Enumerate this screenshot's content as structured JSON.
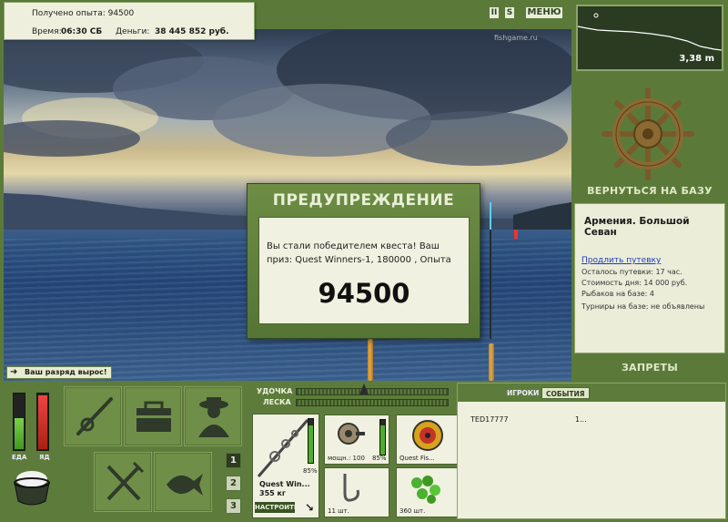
{
  "top_info": {
    "experience_text": "Получено опыта: 94500",
    "time_label": "Время:",
    "time_value": "06:30 СБ",
    "money_label": "Деньги:",
    "money_value": "38 445 852 руб."
  },
  "top_buttons": {
    "pause": "II",
    "sound": "S",
    "menu": "МЕНЮ"
  },
  "watermark": "fishgame.ru",
  "minimap": {
    "depth": "3,38 m"
  },
  "base": {
    "return_label": "ВЕРНУТЬСЯ НА БАЗУ",
    "title": "Армения. Большой Севан",
    "extend_link": "Продлить путевку",
    "remaining": "Осталось путевки: 17 час.",
    "day_cost": "Стоимость дня: 14 000 руб.",
    "fishers": "Рыбаков на базе: 4",
    "tournaments": "Турниры на базе: не объявлены",
    "bans_label": "ЗАПРЕТЫ"
  },
  "modal": {
    "title": "ПРЕДУПРЕЖДЕНИЕ",
    "message": "Вы стали победителем квеста! Ваш приз: Quest Winners-1, 180000 , Опыта",
    "value": "94500"
  },
  "rank_note": "Ваш разряд вырос!",
  "status_bars": {
    "food_label": "ЕДА",
    "food_level": 0.55,
    "poison_label": "ЯД",
    "poison_level": 0.95
  },
  "slot_numbers": [
    "1",
    "2",
    "3"
  ],
  "rod_panel": {
    "rod_label": "УДОЧКА",
    "line_label": "ЛЕСКА",
    "rod_name": "Quest Win...",
    "rod_weight": "355 кг",
    "rod_wear": "85%",
    "setup_button": "НАСТРОИТЬ",
    "reel_power": "мощн.: 100",
    "reel_wear": "85%",
    "line_name": "Quest Fis...",
    "hooks_count": "11 шт.",
    "bait_count": "360 шт."
  },
  "players": {
    "tab_players": "ИГРОКИ",
    "tab_events": "СОБЫТИЯ",
    "rows": [
      {
        "name": "TED17777",
        "info": "1..."
      }
    ]
  },
  "colors": {
    "panel_green": "#5d7c3b",
    "panel_light": "#eef0dd",
    "link_blue": "#1f3bbd"
  }
}
